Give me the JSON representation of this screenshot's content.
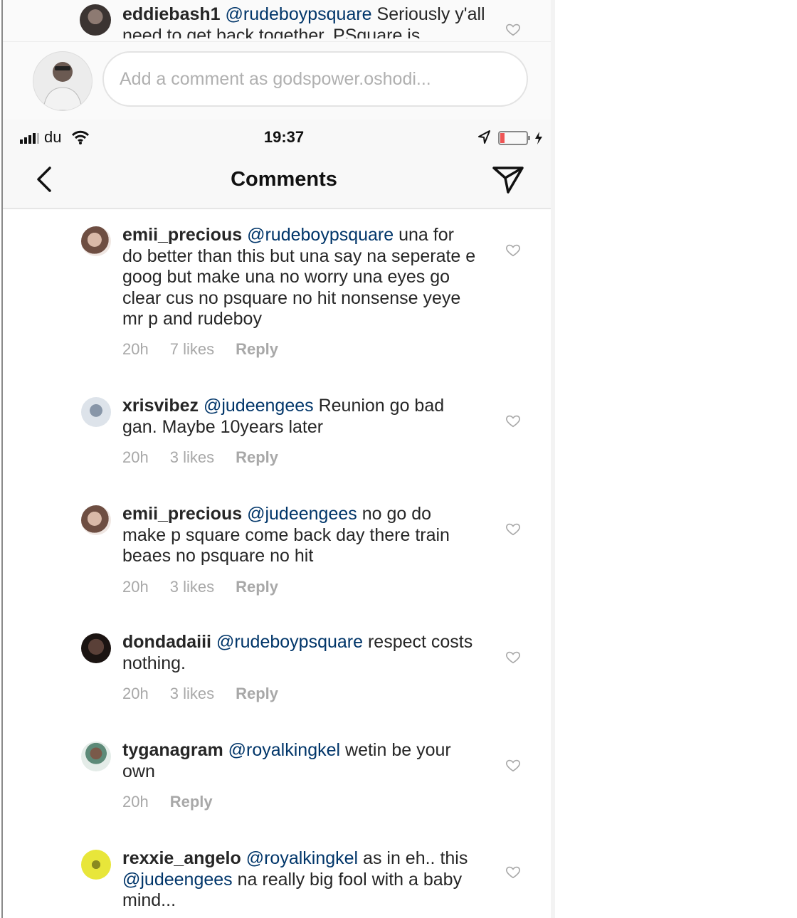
{
  "top_comment": {
    "username": "eddiebash1",
    "mention": "@rudeboypsquare",
    "text": " Seriously y'all need to get back together. PSquare is"
  },
  "add_comment": {
    "placeholder": "Add a comment as godspower.oshodi..."
  },
  "status_bar": {
    "carrier": "du",
    "time": "19:37"
  },
  "header": {
    "title": "Comments"
  },
  "comments": [
    {
      "username": "emii_precious",
      "mention": "@rudeboypsquare",
      "text": " una for do better than this but una say na seperate e goog but  make una no worry una eyes  go clear cus no  psquare no hit nonsense yeye mr p and rudeboy",
      "time": "20h",
      "likes": "7 likes",
      "reply": "Reply"
    },
    {
      "username": "xrisvibez",
      "mention": "@judeengees",
      "text": " Reunion go bad gan. Maybe 10years later",
      "time": "20h",
      "likes": "3 likes",
      "reply": "Reply"
    },
    {
      "username": "emii_precious",
      "mention": "@judeengees",
      "text": " no go do make p square come back day there train beaes no psquare no hit",
      "time": "20h",
      "likes": "3 likes",
      "reply": "Reply"
    },
    {
      "username": "dondadaiii",
      "mention": "@rudeboypsquare",
      "text": " respect costs nothing.",
      "time": "20h",
      "likes": "3 likes",
      "reply": "Reply"
    },
    {
      "username": "tyganagram",
      "mention": "@royalkingkel",
      "text": " wetin be your own",
      "time": "20h",
      "likes": "",
      "reply": "Reply"
    },
    {
      "username": "rexxie_angelo",
      "mention": "@royalkingkel",
      "text": " as in eh.. this ",
      "mention2": "@judeengees",
      "text2": " na really big fool with a baby mind...",
      "time": "",
      "likes": "",
      "reply": ""
    }
  ],
  "icons": {
    "heart": "heart-icon",
    "back": "chevron-left-icon",
    "send": "paper-plane-icon",
    "signal": "signal-bars-icon",
    "wifi": "wifi-icon",
    "location": "location-arrow-icon",
    "battery": "battery-icon"
  },
  "colors": {
    "mention": "#003569",
    "meta": "#a8a8a8",
    "text": "#262626"
  }
}
